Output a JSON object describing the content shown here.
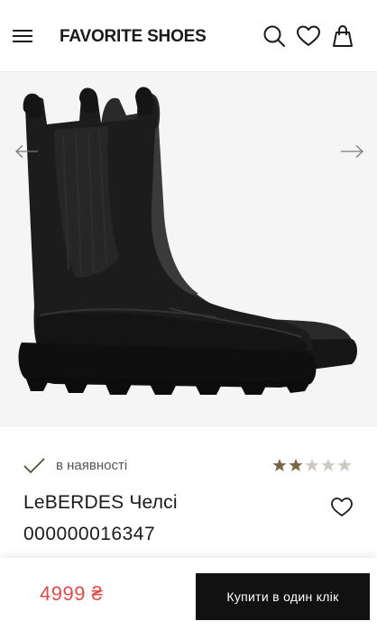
{
  "header": {
    "logo_text": "FAVORITE SHOES",
    "icons": [
      "menu-icon",
      "search-icon",
      "heart-icon",
      "shopping-bag-icon"
    ]
  },
  "gallery": {
    "image_subject": "black leather chelsea boots",
    "icons": [
      "arrow-left-icon",
      "arrow-right-icon"
    ]
  },
  "product": {
    "availability": "в наявності",
    "rating": {
      "value": 2,
      "max": 5
    },
    "name": "LeBERDES Челсі",
    "sku": "000000016347"
  },
  "purchase": {
    "price": "4999 ₴",
    "buy_label": "Купити в один клік"
  },
  "colors": {
    "accent_price": "#e24a4a",
    "star_filled": "#7a6447",
    "star_empty": "#cfc9c0",
    "check": "#5a4a36",
    "buy_button": "#111111"
  }
}
